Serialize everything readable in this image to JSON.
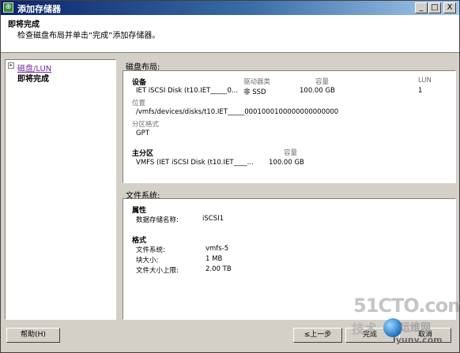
{
  "window": {
    "title": "添加存储器",
    "controls": {
      "minimize": "_",
      "maximize": "□",
      "close": "X"
    }
  },
  "header": {
    "title": "即将完成",
    "subtitle": "检查磁盘布局并单击“完成”添加存储器。"
  },
  "nav": {
    "items": [
      {
        "label": "磁盘/LUN",
        "state": "visited"
      },
      {
        "label": "即将完成",
        "state": "current"
      }
    ]
  },
  "disk_layout": {
    "section_label": "磁盘布局:",
    "device_header": "设备",
    "drive_type_header": "驱动器类",
    "capacity_header": "容量",
    "lun_header": "LUN",
    "device_name": "IET iSCSI Disk (t10.IET_____0...",
    "drive_type": "非 SSD",
    "capacity": "100.00 GB",
    "lun": "1",
    "location_label": "位置",
    "location_value": "/vmfs/devices/disks/t10.IET_____0001000100000000000000",
    "partition_format_label": "分区格式",
    "partition_format_value": "GPT",
    "primary_partition_header": "主分区",
    "primary_capacity_header": "容量",
    "primary_partition_name": "VMFS (IET iSCSI Disk (t10.IET____...",
    "primary_capacity": "100.00 GB"
  },
  "file_system": {
    "section_label": "文件系统:",
    "properties_header": "属性",
    "datastore_name_label": "数据存储名称:",
    "datastore_name_value": "iSCSI1",
    "format_header": "格式",
    "fs_label": "文件系统:",
    "fs_value": "vmfs-5",
    "block_size_label": "块大小:",
    "block_size_value": "1 MB",
    "max_file_label": "文件大小上限:",
    "max_file_value": "2.00 TB"
  },
  "buttons": {
    "help": "帮助(H)",
    "back": "≤上一步",
    "finish": "完成",
    "cancel": "取消"
  },
  "watermark": {
    "line1": "51CTO.com",
    "line2": "技术",
    "line3": "运维网",
    "line4": "iyunv.com"
  }
}
